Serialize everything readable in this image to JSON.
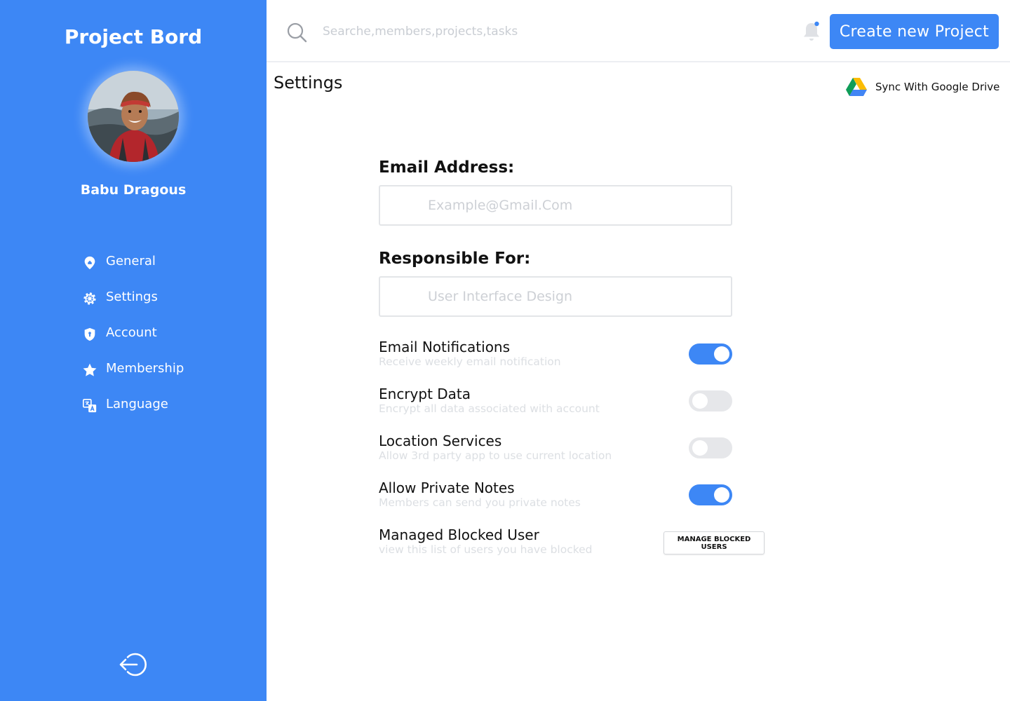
{
  "app": {
    "title": "Project Bord"
  },
  "user": {
    "name": "Babu Dragous"
  },
  "sidebar": {
    "items": [
      {
        "label": "General",
        "icon": "location-pin-icon"
      },
      {
        "label": "Settings",
        "icon": "gear-icon"
      },
      {
        "label": "Account",
        "icon": "shield-icon"
      },
      {
        "label": "Membership",
        "icon": "star-icon"
      },
      {
        "label": "Language",
        "icon": "translate-icon"
      }
    ],
    "logout_icon": "logout-icon"
  },
  "topbar": {
    "search_placeholder": "Searche,members,projects,tasks",
    "create_label": "Create new Project",
    "has_notification": true
  },
  "page": {
    "title": "Settings",
    "sync_label": "Sync With Google Drive"
  },
  "form": {
    "email": {
      "label": "Email Address:",
      "placeholder": "Example@Gmail.Com"
    },
    "responsible": {
      "label": "Responsible For:",
      "placeholder": "User Interface Design"
    }
  },
  "settings": [
    {
      "title": "Email Notifications",
      "subtitle": "Receive weekly email notification",
      "enabled": true
    },
    {
      "title": "Encrypt Data",
      "subtitle": "Encrypt all data associated with account",
      "enabled": false
    },
    {
      "title": "Location Services",
      "subtitle": "Allow 3rd party app to use current location",
      "enabled": false
    },
    {
      "title": "Allow Private Notes",
      "subtitle": "Members can send you private notes",
      "enabled": true
    }
  ],
  "blocked": {
    "title": "Managed Blocked User",
    "subtitle": "view this list of users you have blocked",
    "button_label": "MANAGE BLOCKED USERS"
  },
  "colors": {
    "accent": "#3d87f5",
    "toggle_off": "#e6e7ea",
    "muted_text": "#dcdfe3"
  }
}
